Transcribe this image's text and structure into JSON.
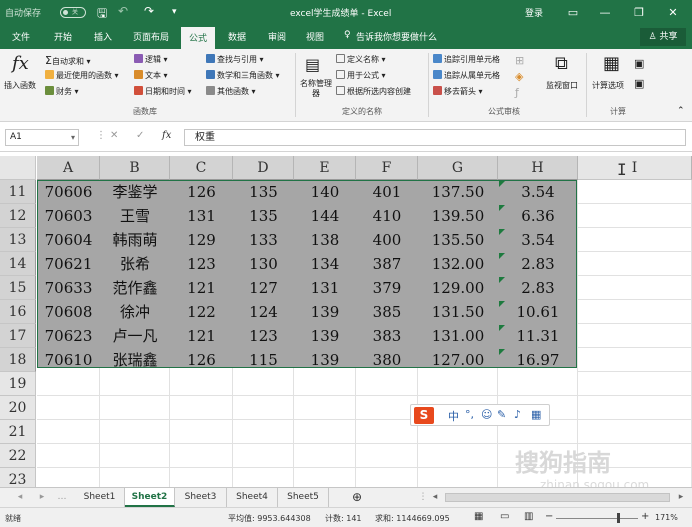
{
  "titlebar": {
    "autosave_label": "自动保存",
    "autosave_state": "关",
    "title": "excel学生成绩单  -  Excel",
    "login": "登录",
    "icons": [
      "save-icon",
      "undo-icon",
      "redo-icon",
      "customize-icon",
      "ribbon-display-icon",
      "minimize-icon",
      "restore-icon",
      "close-icon"
    ]
  },
  "tabs": {
    "items": [
      "文件",
      "开始",
      "插入",
      "页面布局",
      "公式",
      "数据",
      "审阅",
      "视图"
    ],
    "active": "公式",
    "tell_me": "告诉我你想要做什么",
    "share": "共享"
  },
  "ribbon": {
    "insert_function": "插入函数",
    "autosum": "自动求和",
    "recent": "最近使用的函数",
    "finance": "财务",
    "logic": "逻辑",
    "text": "文本",
    "datetime": "日期和时间",
    "lookup": "查找与引用",
    "math": "数学和三角函数",
    "other": "其他函数",
    "group_library": "函数库",
    "name_manager": "名称管理器",
    "define_name": "定义名称",
    "use_in_formula": "用于公式",
    "create_from_selection": "根据所选内容创建",
    "group_names": "定义的名称",
    "trace_precedents": "追踪引用单元格",
    "trace_dependents": "追踪从属单元格",
    "remove_arrows": "移去箭头",
    "group_audit": "公式审核",
    "watch_window": "监视窗口",
    "calc_options": "计算选项",
    "group_calc": "计算"
  },
  "formula_bar": {
    "name_box": "A1",
    "fx": "fx",
    "value": "权重"
  },
  "columns": [
    "A",
    "B",
    "C",
    "D",
    "E",
    "F",
    "G",
    "H",
    "I"
  ],
  "rows": [
    {
      "num": "11",
      "cells": [
        "70606",
        "李鉴学",
        "126",
        "135",
        "140",
        "401",
        "137.50",
        "3.54"
      ]
    },
    {
      "num": "12",
      "cells": [
        "70603",
        "王雪",
        "131",
        "135",
        "144",
        "410",
        "139.50",
        "6.36"
      ]
    },
    {
      "num": "13",
      "cells": [
        "70604",
        "韩雨萌",
        "129",
        "133",
        "138",
        "400",
        "135.50",
        "3.54"
      ]
    },
    {
      "num": "14",
      "cells": [
        "70621",
        "张希",
        "123",
        "130",
        "134",
        "387",
        "132.00",
        "2.83"
      ]
    },
    {
      "num": "15",
      "cells": [
        "70633",
        "范作鑫",
        "121",
        "127",
        "131",
        "379",
        "129.00",
        "2.83"
      ]
    },
    {
      "num": "16",
      "cells": [
        "70608",
        "徐冲",
        "122",
        "124",
        "139",
        "385",
        "131.50",
        "10.61"
      ]
    },
    {
      "num": "17",
      "cells": [
        "70623",
        "卢一凡",
        "121",
        "123",
        "139",
        "383",
        "131.00",
        "11.31"
      ]
    },
    {
      "num": "18",
      "cells": [
        "70610",
        "张瑞鑫",
        "126",
        "115",
        "139",
        "380",
        "127.00",
        "16.97"
      ]
    }
  ],
  "empty_rows": [
    "19",
    "20",
    "21",
    "22",
    "23"
  ],
  "ime": {
    "logo": "S",
    "lang": "中"
  },
  "watermark": {
    "line1": "搜狗指南",
    "line2": "zhinan.sogou.com"
  },
  "sheets": {
    "items": [
      "Sheet1",
      "Sheet2",
      "Sheet3",
      "Sheet4",
      "Sheet5"
    ],
    "active": "Sheet2",
    "add": "⊕"
  },
  "status": {
    "ready": "就绪",
    "average": "平均值: 9953.644308",
    "count": "计数: 141",
    "sum": "求和: 1144669.095",
    "zoom": "171%"
  }
}
